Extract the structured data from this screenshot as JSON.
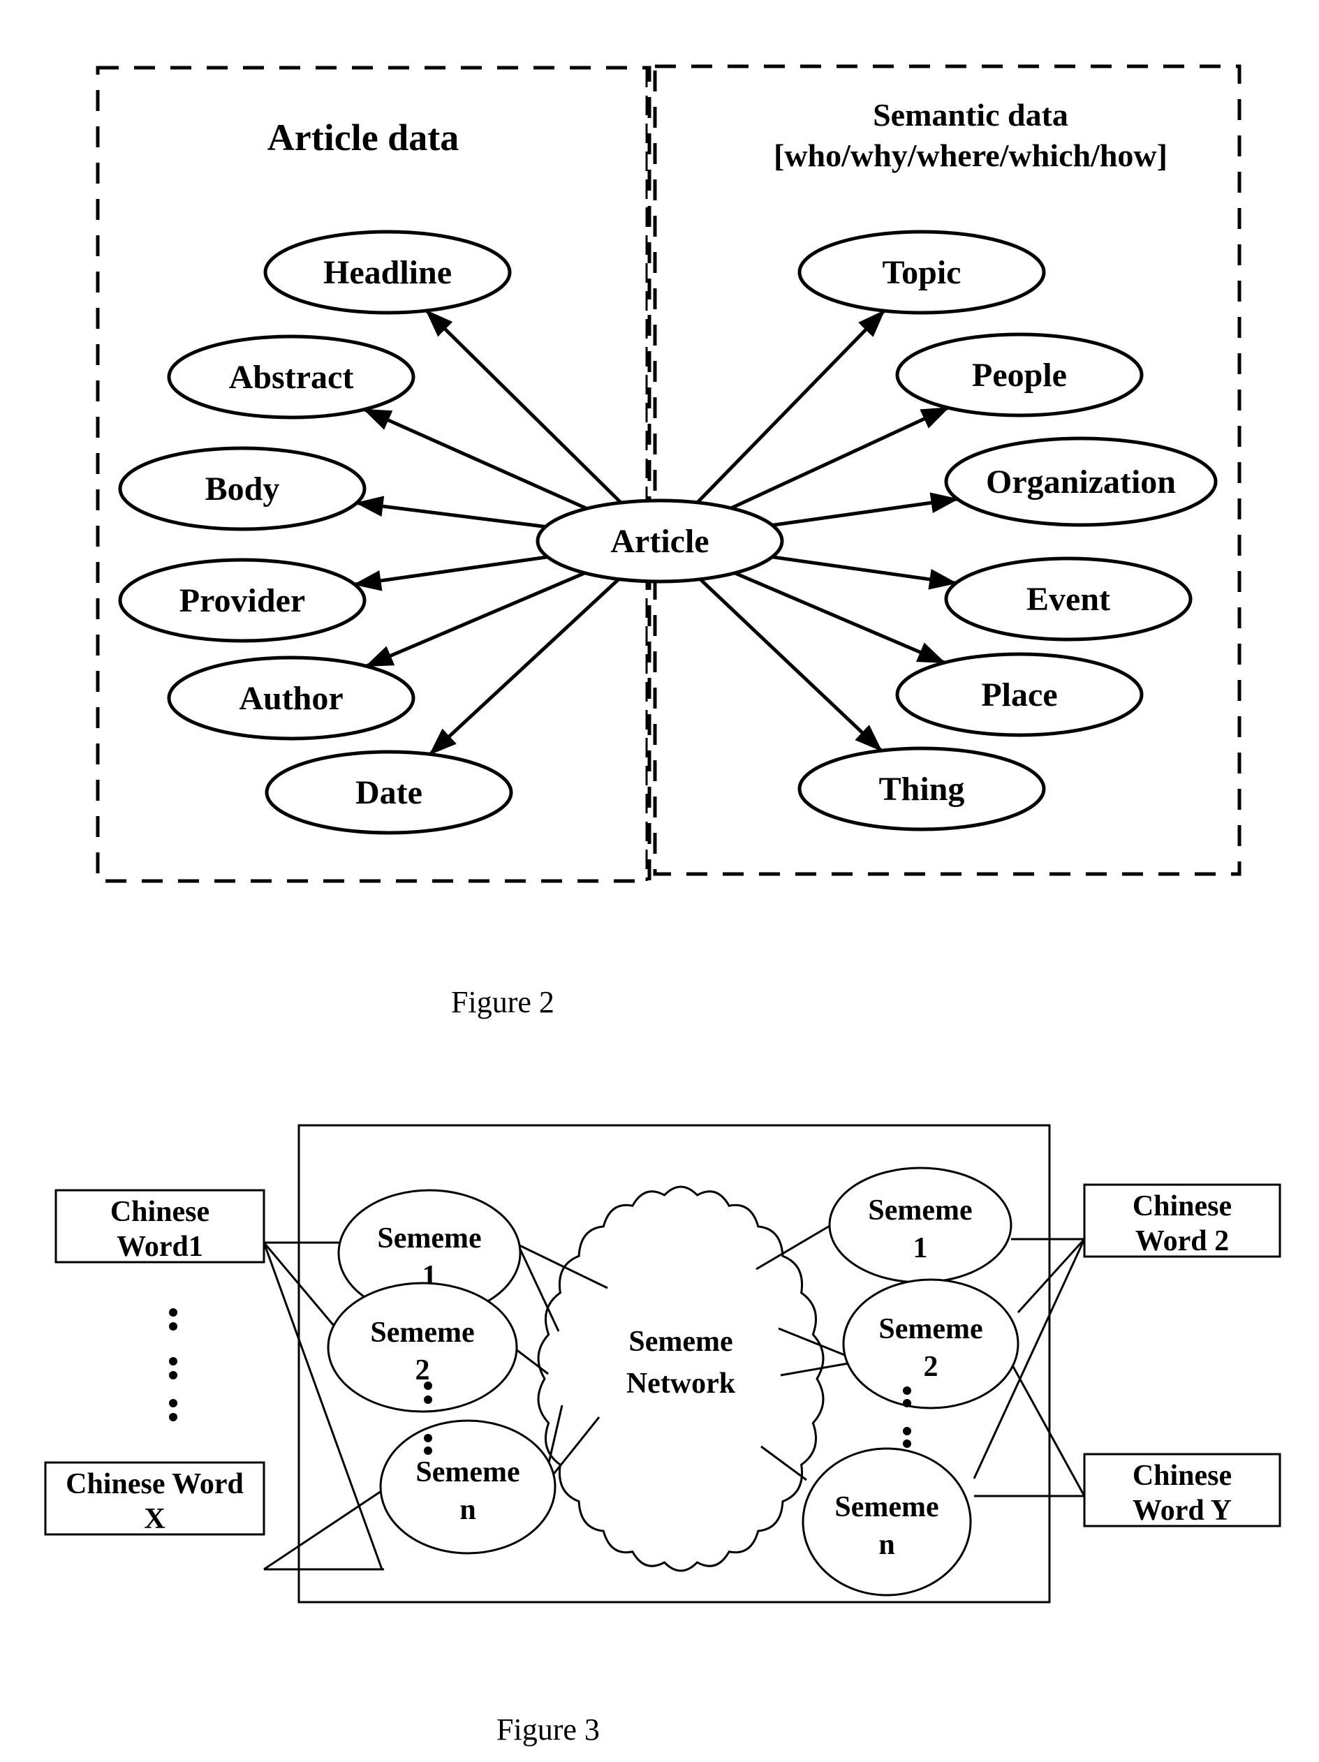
{
  "figure2": {
    "caption": "Figure 2",
    "left_panel": {
      "title": "Article data"
    },
    "right_panel": {
      "title": "Semantic data",
      "subtitle": "[who/why/where/which/how]"
    },
    "center_node": "Article",
    "article_nodes": [
      "Headline",
      "Abstract",
      "Body",
      "Provider",
      "Author",
      "Date"
    ],
    "semantic_nodes": [
      "Topic",
      "People",
      "Organization",
      "Event",
      "Place",
      "Thing"
    ]
  },
  "figure3": {
    "caption": "Figure 3",
    "words_left": [
      {
        "lines": [
          "Chinese",
          "Word1"
        ]
      },
      {
        "lines": [
          "Chinese Word",
          "X"
        ]
      }
    ],
    "words_right": [
      {
        "lines": [
          "Chinese",
          "Word 2"
        ]
      },
      {
        "lines": [
          "Chinese",
          "Word Y"
        ]
      }
    ],
    "sememes_left": [
      {
        "lines": [
          "Sememe",
          "1"
        ]
      },
      {
        "lines": [
          "Sememe",
          "2"
        ]
      },
      {
        "lines": [
          "Sememe",
          "n"
        ]
      }
    ],
    "sememes_right": [
      {
        "lines": [
          "Sememe",
          "1"
        ]
      },
      {
        "lines": [
          "Sememe",
          "2"
        ]
      },
      {
        "lines": [
          "Sememe",
          "n"
        ]
      }
    ],
    "network": {
      "lines": [
        "Sememe",
        "Network"
      ]
    },
    "ellipsis": "⋮"
  }
}
